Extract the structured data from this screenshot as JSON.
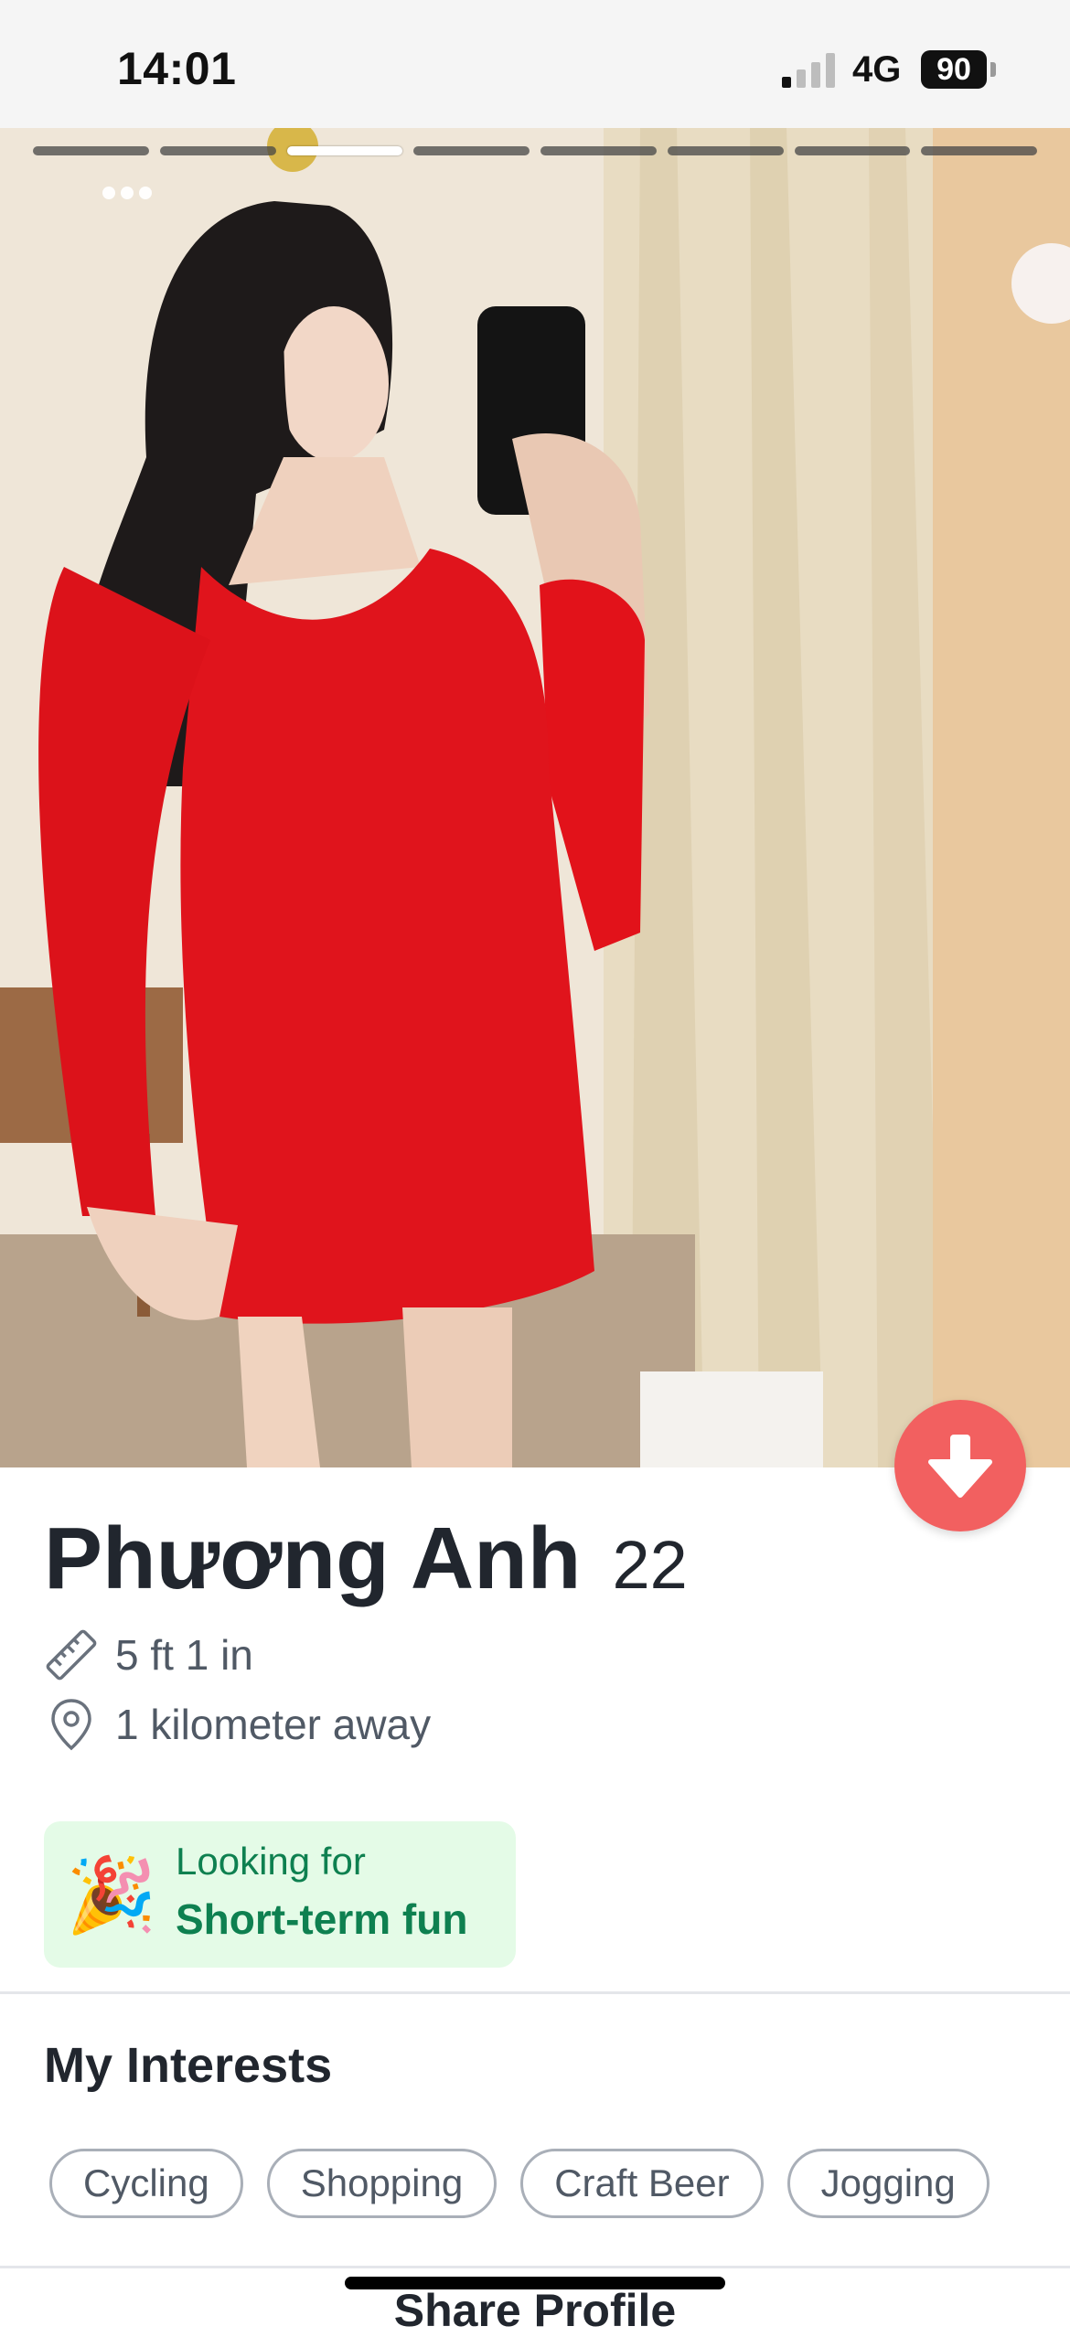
{
  "status_bar": {
    "time": "14:01",
    "network": "4G",
    "battery": "90"
  },
  "photo": {
    "total_photos": 8,
    "active_index": 2
  },
  "profile": {
    "name": "Phương Anh",
    "age": "22",
    "height": "5 ft 1 in",
    "distance": "1 kilometer away"
  },
  "looking_for": {
    "emoji": "🎉",
    "label": "Looking for",
    "value": "Short-term fun"
  },
  "interests": {
    "title": "My Interests",
    "items": [
      "Cycling",
      "Shopping",
      "Craft Beer",
      "Jogging"
    ]
  },
  "share": {
    "label": "Share Profile"
  },
  "colors": {
    "accent": "#f26060",
    "looking_bg": "#e4fbe7",
    "looking_text": "#0e8050"
  }
}
